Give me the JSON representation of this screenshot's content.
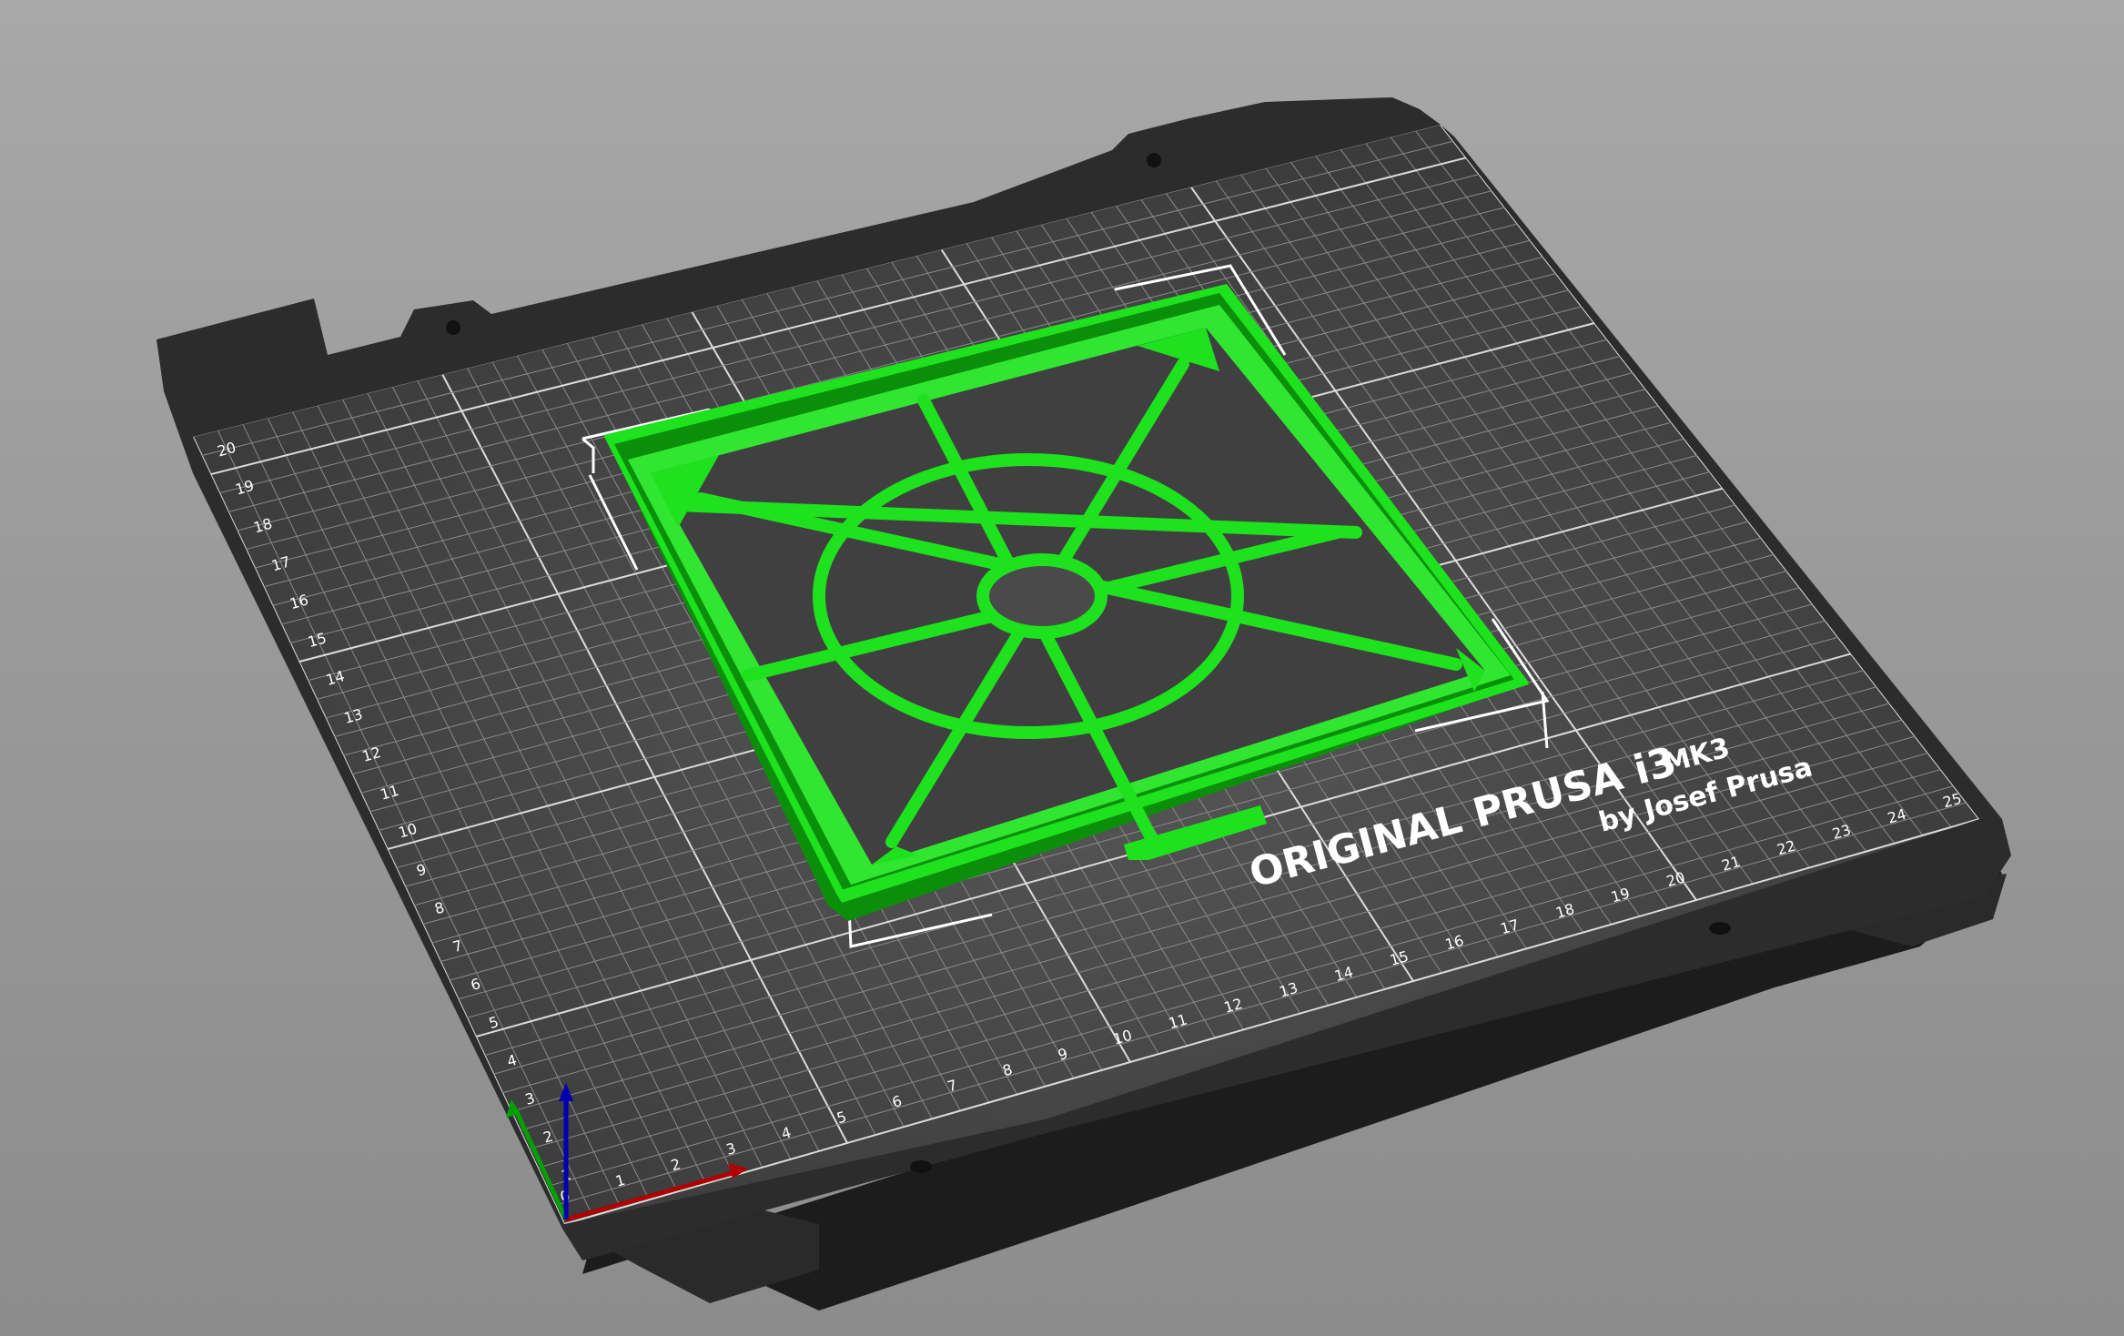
{
  "bed": {
    "brand_line": "ORIGINAL PRUSA i3",
    "model": "MK3",
    "byline": "by Josef Prusa",
    "x_ticks": [
      "0",
      "1",
      "2",
      "3",
      "4",
      "5",
      "6",
      "7",
      "8",
      "9",
      "10",
      "11",
      "12",
      "13",
      "14",
      "15",
      "16",
      "17",
      "18",
      "19",
      "20",
      "21",
      "22",
      "23",
      "24",
      "25"
    ],
    "y_ticks": [
      "1",
      "2",
      "3",
      "4",
      "5",
      "6",
      "7",
      "8",
      "9",
      "10",
      "11",
      "12",
      "13",
      "14",
      "15",
      "16",
      "17",
      "18",
      "19",
      "20"
    ]
  },
  "colors": {
    "background": "#9a9a9a",
    "bed_surface": "#3a3a3a",
    "bed_edge": "#262626",
    "model_green": "#19e619",
    "x_axis": "#b00000",
    "y_axis": "#00a000",
    "z_axis": "#0000b0"
  },
  "icons": {
    "axes": "xyz-axes-gizmo",
    "object": "fan-guard-object"
  }
}
